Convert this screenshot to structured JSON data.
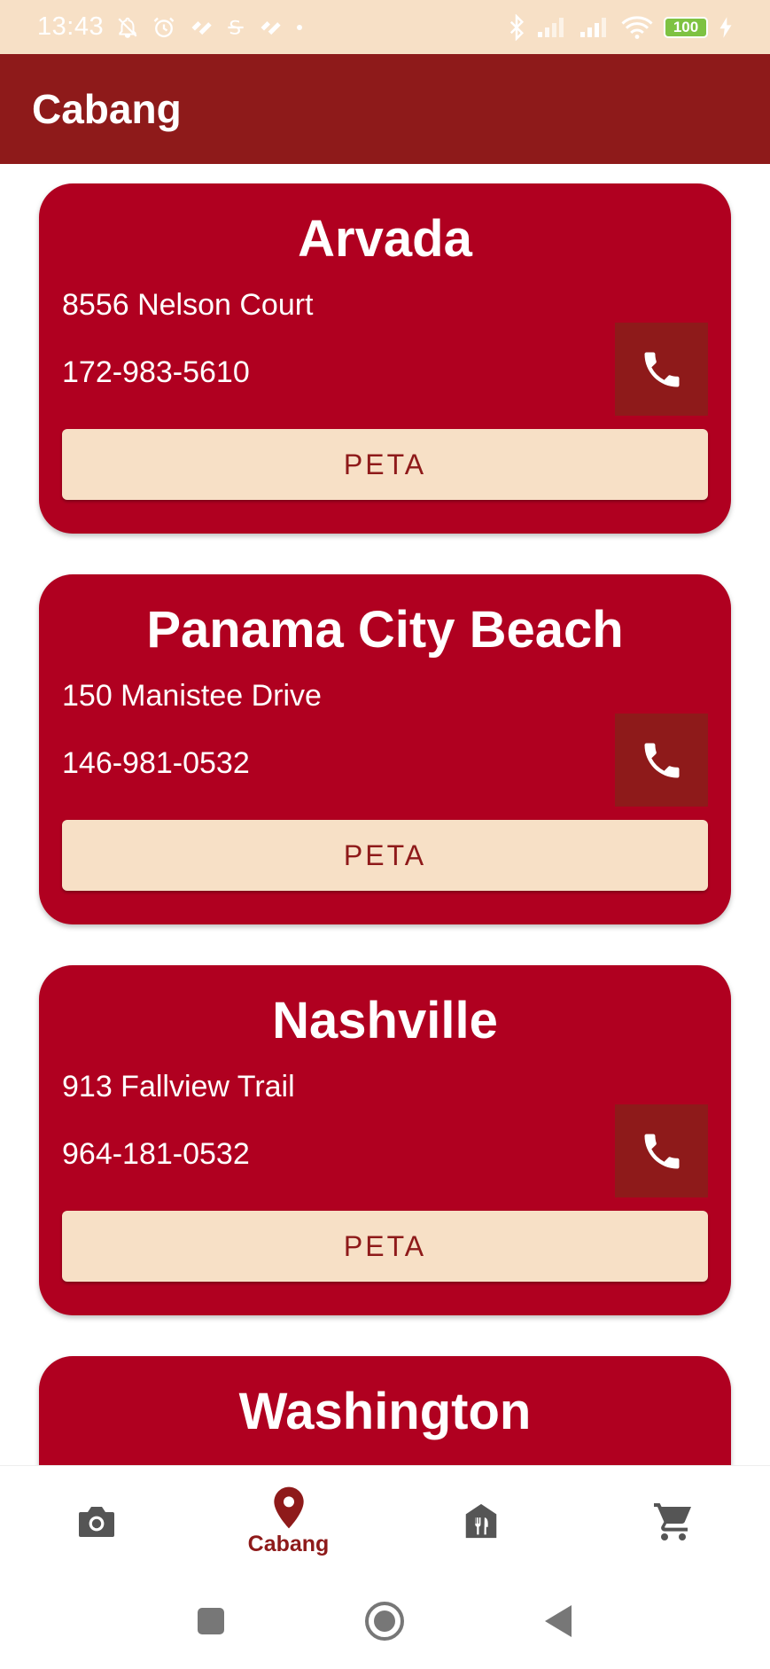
{
  "status_bar": {
    "time": "13:43",
    "battery": "100",
    "icons_left": [
      "mute-bell-icon",
      "alarm-icon",
      "app-notification-icon",
      "app-s-icon",
      "app-notification-icon",
      "dot-icon"
    ],
    "icons_right": [
      "bluetooth-icon",
      "signal-icon",
      "signal-icon",
      "wifi-icon",
      "battery-icon",
      "charging-icon"
    ],
    "bg_color": "#f7e0c6"
  },
  "app_bar": {
    "title": "Cabang",
    "bg_color": "#8e1a1a"
  },
  "branches": [
    {
      "name": "Arvada",
      "address": "8556 Nelson Court",
      "phone": "172-983-5610",
      "map_label": "PETA"
    },
    {
      "name": "Panama City Beach",
      "address": "150 Manistee Drive",
      "phone": "146-981-0532",
      "map_label": "PETA"
    },
    {
      "name": "Nashville",
      "address": "913 Fallview Trail",
      "phone": "964-181-0532",
      "map_label": "PETA"
    },
    {
      "name": "Washington",
      "address": "",
      "phone": "",
      "map_label": ""
    }
  ],
  "bottom_nav": {
    "items": [
      {
        "icon": "camera-icon",
        "label": ""
      },
      {
        "icon": "location-pin-icon",
        "label": "Cabang",
        "active": true
      },
      {
        "icon": "restaurant-icon",
        "label": ""
      },
      {
        "icon": "cart-icon",
        "label": ""
      }
    ]
  },
  "colors": {
    "card": "#b00020",
    "accent": "#8e1a1a",
    "cream": "#f7e0c6",
    "inactive_icon": "#555555"
  }
}
